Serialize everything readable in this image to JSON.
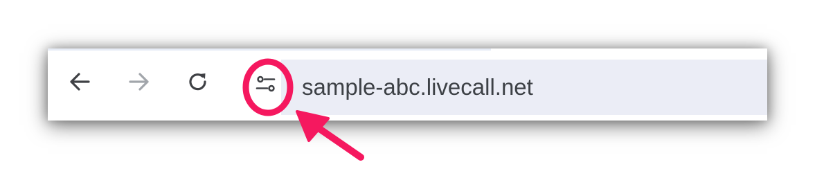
{
  "toolbar": {
    "back_icon": "arrow-left-icon",
    "forward_icon": "arrow-right-icon",
    "reload_icon": "reload-icon",
    "site_info_icon": "tune-sliders-icon",
    "address": "sample-abc.livecall.net"
  },
  "colors": {
    "icon_active": "#3f4145",
    "icon_disabled": "#a2a6ab",
    "omnibox_bg": "#ebedf6",
    "url_text": "#3d4146",
    "annotation_accent": "#f5185f"
  }
}
